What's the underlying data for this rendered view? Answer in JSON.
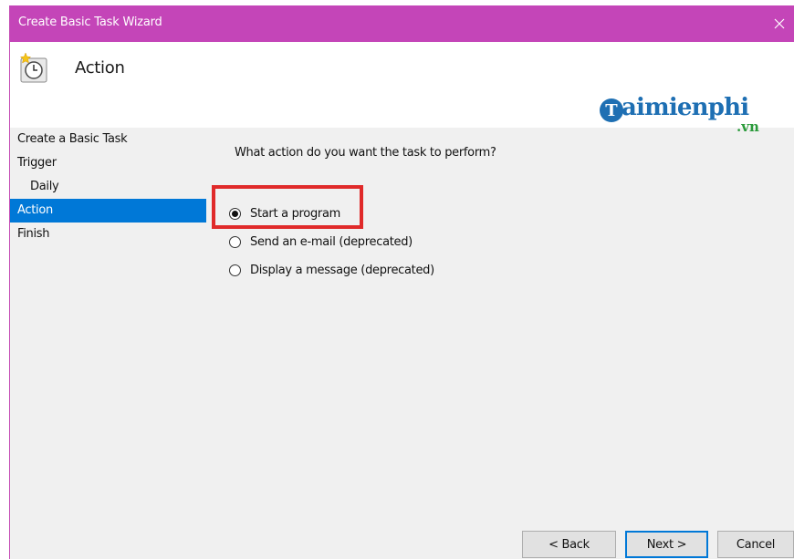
{
  "window": {
    "title": "Create Basic Task Wizard",
    "accent_color": "#c445b8",
    "close_icon": "close-icon"
  },
  "header": {
    "title": "Action",
    "icon": "task-clock-icon"
  },
  "watermark": {
    "logo_letter": "T",
    "text": "aimienphi",
    "sub": ".vn"
  },
  "sidebar": {
    "items": [
      {
        "label": "Create a Basic Task",
        "active": false
      },
      {
        "label": "Trigger",
        "active": false
      },
      {
        "label": "Daily",
        "active": false
      },
      {
        "label": "Action",
        "active": true
      },
      {
        "label": "Finish",
        "active": false
      }
    ]
  },
  "main": {
    "question": "What action do you want the task to perform?",
    "options": [
      {
        "label": "Start a program",
        "checked": true
      },
      {
        "label": "Send an e-mail (deprecated)",
        "checked": false
      },
      {
        "label": "Display a message (deprecated)",
        "checked": false
      }
    ]
  },
  "buttons": {
    "back": "< Back",
    "next": "Next >",
    "cancel": "Cancel"
  }
}
